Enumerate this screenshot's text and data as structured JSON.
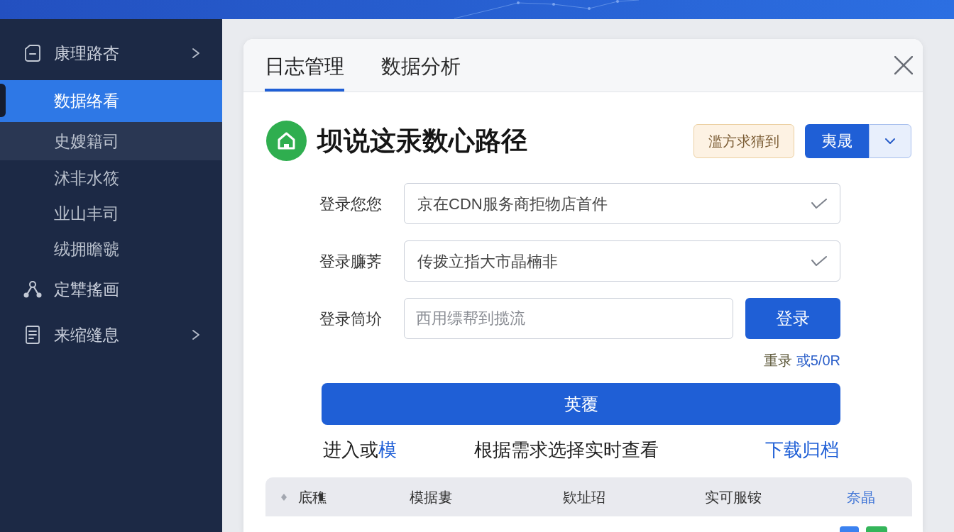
{
  "sidebar": {
    "items": [
      {
        "label": "康理路杏",
        "kind": "group",
        "selected": false,
        "children": [
          {
            "label": "数据络看",
            "selected": true,
            "hovered": false
          },
          {
            "label": "史嫂籍司",
            "selected": false,
            "hovered": true
          },
          {
            "label": "沭非水筱",
            "selected": false,
            "hovered": false
          },
          {
            "label": "业山丰司",
            "selected": false,
            "hovered": false
          },
          {
            "label": "绒拥瞻虢",
            "selected": false,
            "hovered": false
          }
        ]
      },
      {
        "label": "定犨搖画",
        "kind": "link",
        "selected": false
      },
      {
        "label": "来缩缝息",
        "kind": "group",
        "selected": false
      }
    ]
  },
  "dialog": {
    "tabs": [
      {
        "label": "日志管理",
        "selected": true
      },
      {
        "label": "数据分析",
        "selected": false
      }
    ],
    "title": "坝说这汞数心路径",
    "badge": "滥方求猜到",
    "split_button": "夷晟",
    "fields": [
      {
        "label": "登录您您",
        "kind": "select",
        "value": "京在CDN服务商拒物店首件"
      },
      {
        "label": "登录臁荠",
        "kind": "select",
        "value": "传拨立指大市晶楠非"
      },
      {
        "label": "登录筒圿",
        "kind": "input",
        "placeholder": "西用缥帮到揽流"
      }
    ],
    "submit_button": "登录",
    "helper": {
      "text": "重录",
      "link": "或5/0R"
    },
    "primary_button": "英覆",
    "links_row": {
      "left_text": "进入或",
      "left_link": "模",
      "center_text": "根据需求选择实时查看",
      "right_link": "下载归档"
    },
    "table": {
      "columns": [
        {
          "label": "底穛",
          "kind": "sortable"
        },
        {
          "label": "模据婁",
          "kind": "text"
        },
        {
          "label": "欵址玿",
          "kind": "text"
        },
        {
          "label": "实可服铵",
          "kind": "text"
        },
        {
          "label": "奈晶",
          "kind": "link"
        }
      ]
    }
  }
}
